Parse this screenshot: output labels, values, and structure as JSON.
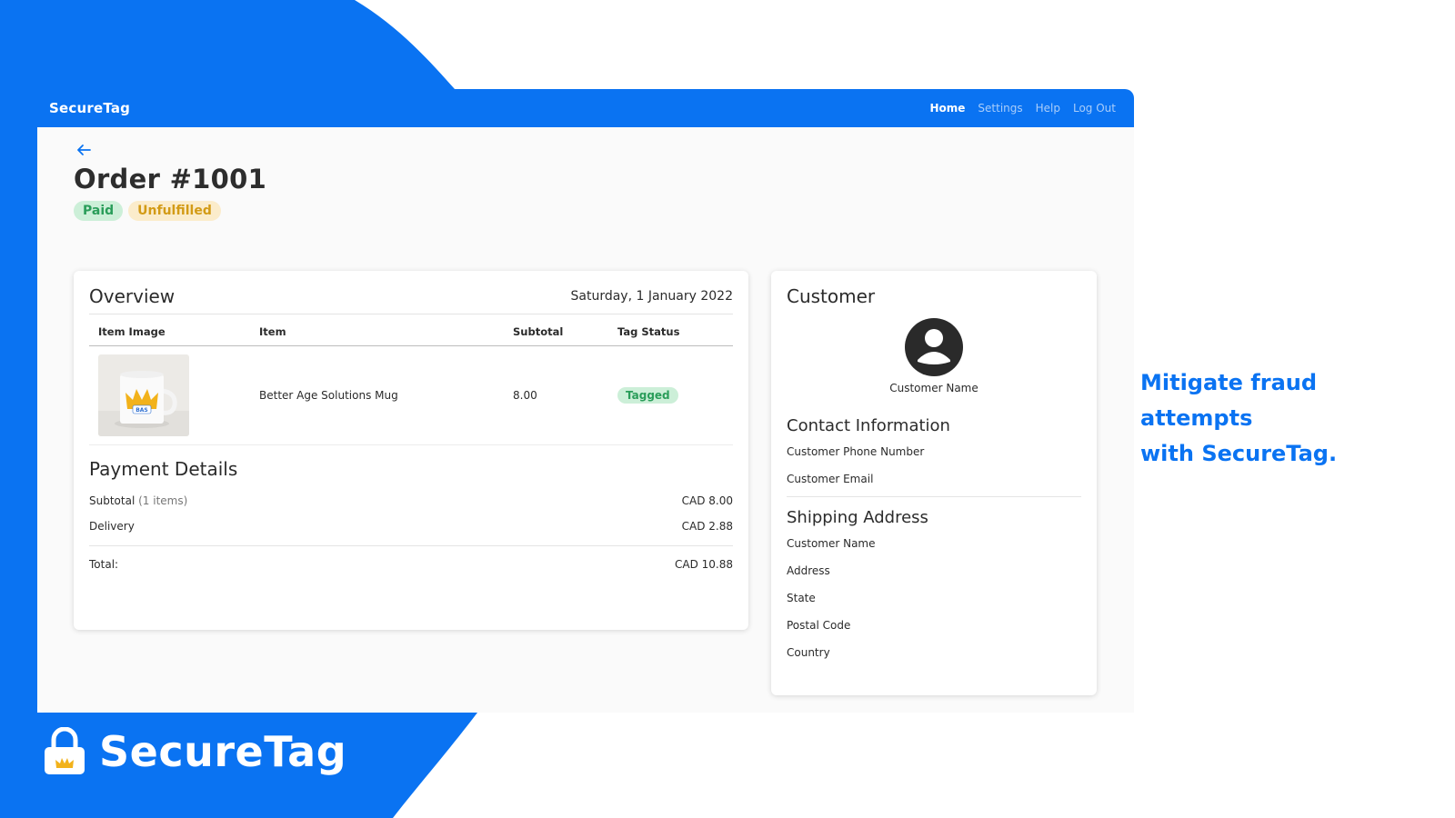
{
  "colors": {
    "brand_blue": "#0a73f2",
    "paid_green": "#2a9d5a",
    "unfulfilled_amber": "#d39b16"
  },
  "header": {
    "brand": "SecureTag",
    "nav": [
      {
        "label": "Home",
        "active": true
      },
      {
        "label": "Settings",
        "active": false
      },
      {
        "label": "Help",
        "active": false
      },
      {
        "label": "Log Out",
        "active": false
      }
    ]
  },
  "order": {
    "back_icon": "arrow-left-icon",
    "title": "Order #1001",
    "payment_badge": "Paid",
    "fulfillment_badge": "Unfulfilled"
  },
  "overview": {
    "title": "Overview",
    "date": "Saturday, 1 January 2022",
    "columns": [
      "Item Image",
      "Item",
      "Subtotal",
      "Tag Status"
    ],
    "items": [
      {
        "image_icon": "mug-image",
        "image_text": "BAS",
        "name": "Better Age Solutions Mug",
        "subtotal": "8.00",
        "tag_status": "Tagged"
      }
    ]
  },
  "payment": {
    "title": "Payment Details",
    "subtotal_label": "Subtotal",
    "subtotal_count": "(1 items)",
    "subtotal_value": "CAD 8.00",
    "delivery_label": "Delivery",
    "delivery_value": "CAD 2.88",
    "total_label": "Total:",
    "total_value": "CAD 10.88"
  },
  "customer": {
    "title": "Customer",
    "avatar_icon": "user-avatar-icon",
    "name": "Customer Name",
    "contact_title": "Contact Information",
    "phone": "Customer Phone Number",
    "email": "Customer Email",
    "shipping_title": "Shipping Address",
    "shipping": [
      "Customer Name",
      "Address",
      "State",
      "Postal Code",
      "Country"
    ]
  },
  "promo": {
    "tagline_line1": "Mitigate fraud attempts",
    "tagline_line2": "with SecureTag.",
    "brand": "SecureTag",
    "logo_icon": "padlock-crown-icon"
  }
}
